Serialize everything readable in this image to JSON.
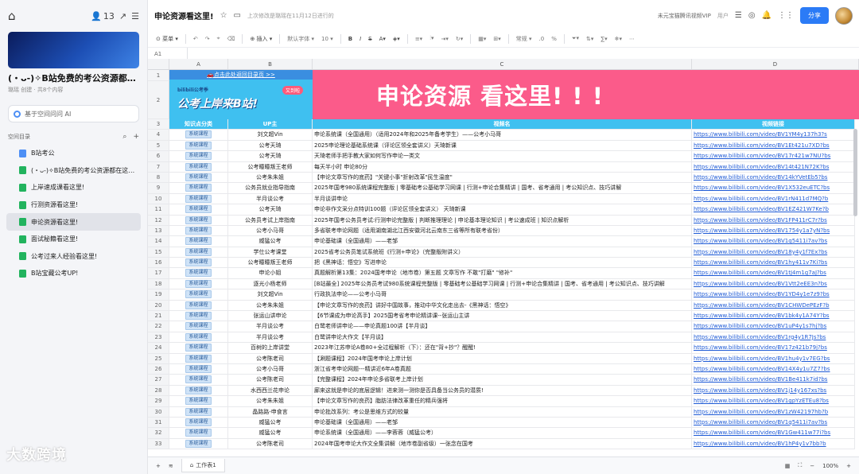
{
  "sidebar": {
    "home_icon": "home-icon",
    "members_count": "13",
    "space_title": "(・ᴗ-)✧B站免费的考公资源都在这里了",
    "space_meta": "璐瑶 创建 · 共8个内容",
    "ai_placeholder": "基于空间问问 AI",
    "dir_label": "空间目录",
    "items": [
      {
        "label": "B站考公",
        "icon": "grid-doc",
        "color": "#4d8ff5"
      },
      {
        "label": "(・ᴗ-)✧B站免费的考公资源都在这了...",
        "icon": "sheet-doc",
        "color": "#22b35e"
      },
      {
        "label": "上岸速成课看这里!",
        "icon": "sheet-doc",
        "color": "#22b35e"
      },
      {
        "label": "行测资源看这里!",
        "icon": "sheet-doc",
        "color": "#22b35e"
      },
      {
        "label": "申论资源看这里!",
        "icon": "sheet-doc",
        "color": "#22b35e"
      },
      {
        "label": "面试秘籍看这里!",
        "icon": "sheet-doc",
        "color": "#22b35e"
      },
      {
        "label": "公考过来人经验看这里!",
        "icon": "sheet-doc",
        "color": "#22b35e"
      },
      {
        "label": "B站宝藏公考UP!",
        "icon": "sheet-doc",
        "color": "#22b35e"
      }
    ],
    "watermark": "大数跨境"
  },
  "header": {
    "title": "申论资源看这里!",
    "saved": "上次修改是璐瑶在11月12日进行的",
    "vip": "未元宝猫腾讯视频VIP",
    "user": "用户",
    "share": "分享"
  },
  "toolbar": {
    "menu": "菜单",
    "insert": "插入",
    "font": "默认字体",
    "size": "10",
    "format": "常规"
  },
  "formula": {
    "cellref": "A1"
  },
  "columns": [
    "A",
    "B",
    "C",
    "D"
  ],
  "banner": {
    "link": "🚗点击此处返回目录页 >>",
    "bili": "bilibili公考季",
    "slogan": "公考上岸来B站!",
    "pill": "又到啦",
    "big": "申论资源 看这里! ! !"
  },
  "table_header": {
    "a": "知识点分类",
    "b": "UP主",
    "c": "视频名",
    "d": "视频链接"
  },
  "rows": [
    {
      "n": "4",
      "a": "系统课程",
      "b": "刘文超Vin",
      "c": "申论系统课（全国通用）（适用2024年和2025年备考学生）——公考小马哥",
      "d": "https://www.bilibili.com/video/BV1YM4y137h3?s"
    },
    {
      "n": "5",
      "a": "系统课程",
      "b": "公考天琦",
      "c": "2025申论理论基础系统课（评论区领全套讲义）天琦新课",
      "d": "https://www.bilibili.com/video/BV1Et421u7XD?bs"
    },
    {
      "n": "6",
      "a": "系统课程",
      "b": "公考天琦",
      "c": "天琦老师手把手教大家如何写作申论一类文",
      "d": "https://www.bilibili.com/video/BV17r421w7NU?bs"
    },
    {
      "n": "7",
      "a": "系统课程",
      "b": "公考瞳瞳叛王老师",
      "c": "每天半小时 申论80分",
      "d": "https://www.bilibili.com/video/BV14t421N72K?bs"
    },
    {
      "n": "8",
      "a": "系统课程",
      "b": "公考朱朱姐",
      "c": "【申论文章写作的底药】\"关键小事\"折射改革\"民生温度\"",
      "d": "https://www.bilibili.com/video/BV14kYVetEb5?bs"
    },
    {
      "n": "9",
      "a": "系统课程",
      "b": "公务员就业指导指南",
      "c": "2025年国考980系统课程完整版 | 零基础考公基础学习网课 | 行测+申论合集精讲 | 国考、省考通用 | 考公知识点、技巧讲解",
      "d": "https://www.bilibili.com/video/BV1X532euETC?bs"
    },
    {
      "n": "10",
      "a": "系统课程",
      "b": "半月谈公考",
      "c": "半月谈讲申论",
      "d": "https://www.bilibili.com/video/BV1rN411d7MQ?b"
    },
    {
      "n": "11",
      "a": "系统课程",
      "b": "公考天琦",
      "c": "申论非作文采分点特训100题（评论区领全套讲义） 天琦新课",
      "d": "https://www.bilibili.com/video/BV1EZ421W7Ke?b"
    },
    {
      "n": "12",
      "a": "系统课程",
      "b": "公务员考试上岸指南",
      "c": "2025年国考公务员考试:行测申论完整版 | 判断推理理论 | 申论基本理论知识 | 考公速成班 | 知识点解析",
      "d": "https://www.bilibili.com/video/BV1FP411rC7r?bs"
    },
    {
      "n": "13",
      "a": "系统课程",
      "b": "公考小马哥",
      "c": "多省联考申论网题（适用湖南湖北江西安徽河北云南东三省等所有联考省份）",
      "d": "https://www.bilibili.com/video/BV1754y1a7yN?bs"
    },
    {
      "n": "14",
      "a": "系统课程",
      "b": "威猛公考",
      "c": "申论基础课（全国通用）——老邹",
      "d": "https://www.bilibili.com/video/BV1q5411i7av?bs"
    },
    {
      "n": "15",
      "a": "系统课程",
      "b": "学仕公考课堂",
      "c": "2025省考公务员笔试系统班《行测+申论》（完整版附讲义）",
      "d": "https://www.bilibili.com/video/BV18y4y1f7Ex?bs"
    },
    {
      "n": "16",
      "a": "系统课程",
      "b": "公考瞳瞳叛王老师",
      "c": "把《黑神话：悟空》写进申论",
      "d": "https://www.bilibili.com/video/BV1hy411v7Ki?bs"
    },
    {
      "n": "17",
      "a": "系统课程",
      "b": "申论小姐",
      "c": "真题解析第13集：2024国考申论（地市卷）第五题 文章写作 不敢\"打磨\" \"修补\"",
      "d": "https://www.bilibili.com/video/BV1tJ4m1g7aJ?bs"
    },
    {
      "n": "18",
      "a": "系统课程",
      "b": "逐光小杨老师",
      "c": "[B站最全] 2025年公务员考试980系统课程完整版 | 零基础考公基础学习网课 | 行测+申论合集精讲 | 国考、省考通用 | 考公知识点、技巧讲解",
      "d": "https://www.bilibili.com/video/BV1Vtt2eEE3n?bs"
    },
    {
      "n": "19",
      "a": "系统课程",
      "b": "刘文超Vin",
      "c": "行政执法申论——公考小马哥",
      "d": "https://www.bilibili.com/video/BV1YD4y1e7z9?bs"
    },
    {
      "n": "20",
      "a": "系统课程",
      "b": "公考朱朱姐",
      "c": "【申论文章写作的良药】讲好中国故事，推动中华文化走出去-《黑神话：悟空》",
      "d": "https://www.bilibili.com/video/BV1CHWDePEzF?b"
    },
    {
      "n": "21",
      "a": "系统课程",
      "b": "张运山讲申论",
      "c": "【6节课成为申论高手】2025国考省考申论精讲课--张运山主讲",
      "d": "https://www.bilibili.com/video/BV1bk4y1A74Y?bs"
    },
    {
      "n": "22",
      "a": "系统课程",
      "b": "半月谈公考",
      "c": "白鹭老师讲申论——申论真题100讲【半月谈】",
      "d": "https://www.bilibili.com/video/BV1uP4y1s7hj?bs"
    },
    {
      "n": "23",
      "a": "系统课程",
      "b": "半月谈公考",
      "c": "白鹭讲申论大作文【半月谈】",
      "d": "https://www.bilibili.com/video/BV1rg4y1R7Js?bs"
    },
    {
      "n": "24",
      "a": "系统课程",
      "b": "百树的上岸讲堂",
      "c": "2023年江苏申论A卷80+全过程解析（下）：还在\"背+抄\"？醒醒!",
      "d": "https://www.bilibili.com/video/BV17z421b79j?bs"
    },
    {
      "n": "25",
      "a": "系统课程",
      "b": "公考陈老司",
      "c": "【涮题课程】2024年国考申论上岸计划",
      "d": "https://www.bilibili.com/video/BV1hu4y1v7EG?bs"
    },
    {
      "n": "26",
      "a": "系统课程",
      "b": "公考小马哥",
      "c": "浙江省考申论网题---精讲近6年A卷真题",
      "d": "https://www.bilibili.com/video/BV14X4y1u7Z7?bs"
    },
    {
      "n": "27",
      "a": "系统课程",
      "b": "公考陈老司",
      "c": "【完整课程】2024年申论多省联考上岸计划",
      "d": "https://www.bilibili.com/video/BV1Be411k7id?bs"
    },
    {
      "n": "28",
      "a": "系统课程",
      "b": "水西西兰花申论",
      "c": "廊来这就是申论的底层逻辑！进来测一测你是否具备当公务员的潜质!",
      "d": "https://www.bilibili.com/video/BV1j14y167xs?bs"
    },
    {
      "n": "29",
      "a": "系统课程",
      "b": "公考朱朱姐",
      "c": "【申论文章写作的良药】脂肪法律改革重任的精兵强将",
      "d": "https://www.bilibili.com/video/BV1gpYzETEu8?bs"
    },
    {
      "n": "30",
      "a": "系统课程",
      "b": "晶路路-申食言",
      "c": "申论批改系列：考公是思维方式的较量",
      "d": "https://www.bilibili.com/video/BV1zW42197hb?b"
    },
    {
      "n": "31",
      "a": "系统课程",
      "b": "威猛公考",
      "c": "申论基础课（全国通用）——老邹",
      "d": "https://www.bilibili.com/video/BV1q5411i7av?bs"
    },
    {
      "n": "32",
      "a": "系统课程",
      "b": "威猛公考",
      "c": "申论系统课（全国通用）——李蓉蓉（威猛公考）",
      "d": "https://www.bilibili.com/video/BV1Gw411w77i?bs"
    },
    {
      "n": "33",
      "a": "系统课程",
      "b": "公考陈老司",
      "c": "2024年国考申论大作文全集讲解（地市卷副省级）一张念在国考",
      "d": "https://www.bilibili.com/video/BV1hP4y1v7bb?b"
    }
  ],
  "bottom": {
    "sheet": "工作表1",
    "zoom": "100%"
  }
}
